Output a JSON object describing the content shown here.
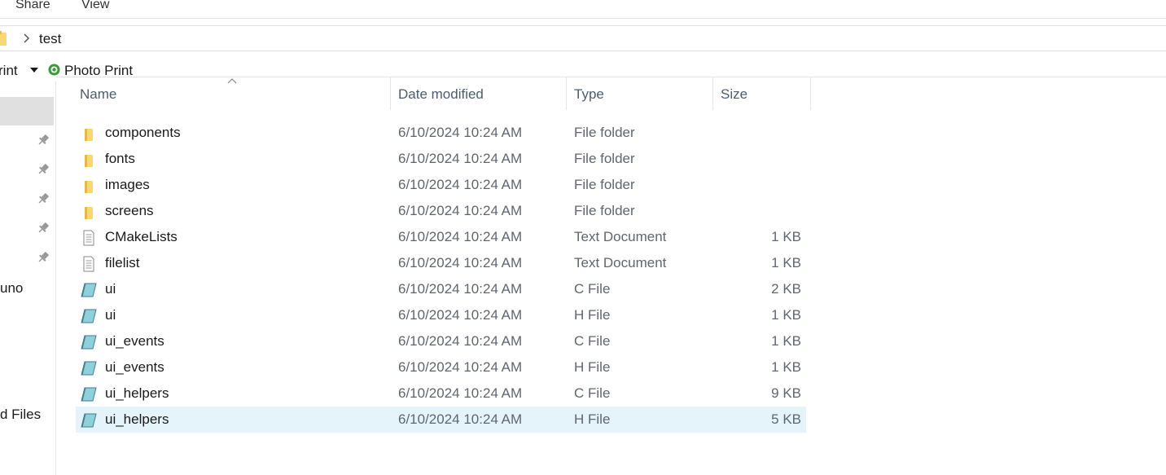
{
  "ribbon": {
    "tabs": [
      {
        "label": "Share"
      },
      {
        "label": "View"
      }
    ]
  },
  "address": {
    "crumbs": [
      {
        "label": "test"
      }
    ]
  },
  "toolbar": {
    "print_label": "rint",
    "photo_print_label": "Photo Print"
  },
  "nav": {
    "items": [
      {
        "label": "uno"
      },
      {
        "label": "d Files"
      }
    ]
  },
  "columns": {
    "name": "Name",
    "date": "Date modified",
    "type": "Type",
    "size": "Size"
  },
  "files": [
    {
      "name": "components",
      "date": "6/10/2024 10:24 AM",
      "type": "File folder",
      "size": "",
      "icon": "folder-icon"
    },
    {
      "name": "fonts",
      "date": "6/10/2024 10:24 AM",
      "type": "File folder",
      "size": "",
      "icon": "folder-icon"
    },
    {
      "name": "images",
      "date": "6/10/2024 10:24 AM",
      "type": "File folder",
      "size": "",
      "icon": "folder-icon"
    },
    {
      "name": "screens",
      "date": "6/10/2024 10:24 AM",
      "type": "File folder",
      "size": "",
      "icon": "folder-icon"
    },
    {
      "name": "CMakeLists",
      "date": "6/10/2024 10:24 AM",
      "type": "Text Document",
      "size": "1 KB",
      "icon": "text-document-icon"
    },
    {
      "name": "filelist",
      "date": "6/10/2024 10:24 AM",
      "type": "Text Document",
      "size": "1 KB",
      "icon": "text-document-icon"
    },
    {
      "name": "ui",
      "date": "6/10/2024 10:24 AM",
      "type": "C File",
      "size": "2 KB",
      "icon": "source-file-icon"
    },
    {
      "name": "ui",
      "date": "6/10/2024 10:24 AM",
      "type": "H File",
      "size": "1 KB",
      "icon": "source-file-icon"
    },
    {
      "name": "ui_events",
      "date": "6/10/2024 10:24 AM",
      "type": "C File",
      "size": "1 KB",
      "icon": "source-file-icon"
    },
    {
      "name": "ui_events",
      "date": "6/10/2024 10:24 AM",
      "type": "H File",
      "size": "1 KB",
      "icon": "source-file-icon"
    },
    {
      "name": "ui_helpers",
      "date": "6/10/2024 10:24 AM",
      "type": "C File",
      "size": "9 KB",
      "icon": "source-file-icon"
    },
    {
      "name": "ui_helpers",
      "date": "6/10/2024 10:24 AM",
      "type": "H File",
      "size": "5 KB",
      "icon": "source-file-icon",
      "selected": true
    }
  ],
  "colors": {
    "selection": "#e5f3fb",
    "folder": "#f8d775",
    "header_text": "#4d5c6e"
  }
}
